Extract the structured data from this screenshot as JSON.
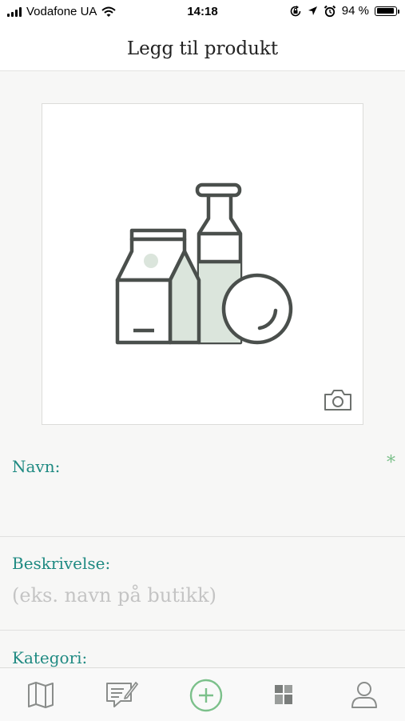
{
  "status_bar": {
    "carrier": "Vodafone UA",
    "time": "14:18",
    "battery_percent": "94 %",
    "battery_level": 0.94,
    "icons": [
      "signal-icon",
      "wifi-icon",
      "rotation-lock-icon",
      "location-arrow-icon",
      "alarm-icon",
      "battery-icon"
    ]
  },
  "nav": {
    "title": "Legg til produkt"
  },
  "photo": {
    "illustration": "grocery-products-illustration",
    "camera_icon": "camera-icon"
  },
  "form": {
    "name": {
      "label": "Navn:",
      "required_mark": "*"
    },
    "description": {
      "label": "Beskrivelse:",
      "placeholder": "(eks. navn på butikk)"
    },
    "category": {
      "label": "Kategori:"
    }
  },
  "tab_bar": {
    "items": [
      {
        "icon": "map-icon"
      },
      {
        "icon": "edit-list-icon"
      },
      {
        "icon": "add-circle-icon",
        "active": true
      },
      {
        "icon": "grid-icon"
      },
      {
        "icon": "profile-icon"
      }
    ]
  },
  "colors": {
    "accent": "#1f8a82",
    "required": "#7bc08a",
    "illustration_stroke": "#4a4f4c",
    "illustration_fill": "#dbe5dc"
  }
}
